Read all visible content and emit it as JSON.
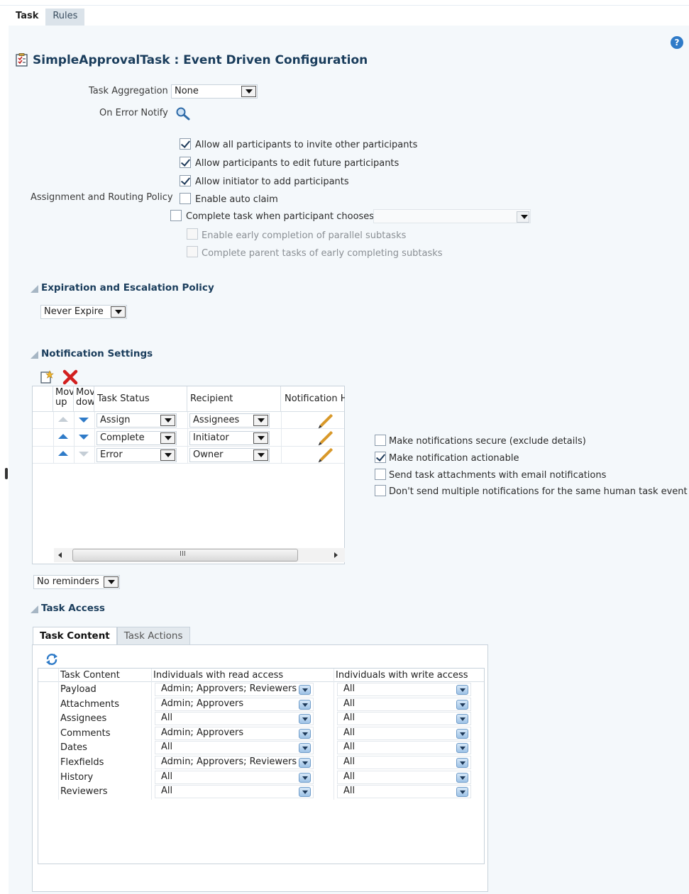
{
  "top_tabs": [
    "Task",
    "Rules"
  ],
  "title": "SimpleApprovalTask : Event Driven Configuration",
  "help_label": "?",
  "task_aggregation": {
    "label": "Task Aggregation",
    "value": "None"
  },
  "on_error_notify": {
    "label": "On Error Notify"
  },
  "assignment_label": "Assignment and Routing Policy",
  "assignment_options": [
    {
      "label": "Allow all participants to invite other participants",
      "checked": true
    },
    {
      "label": "Allow participants to edit future participants",
      "checked": true
    },
    {
      "label": "Allow initiator to add participants",
      "checked": true
    },
    {
      "label": "Enable auto claim",
      "checked": false
    },
    {
      "label": "Complete task when participant chooses",
      "checked": false
    },
    {
      "label": "Enable early completion of parallel subtasks",
      "checked": false,
      "disabled": true
    },
    {
      "label": "Complete parent tasks of early completing subtasks",
      "checked": false,
      "disabled": true
    }
  ],
  "expiration": {
    "header": "Expiration and Escalation Policy",
    "value": "Never Expire"
  },
  "notification": {
    "header": "Notification Settings",
    "columns": [
      "Mov up",
      "Mov dow",
      "Task Status",
      "Recipient",
      "Notification H"
    ],
    "rows": [
      {
        "status": "Assign",
        "recipient": "Assignees"
      },
      {
        "status": "Complete",
        "recipient": "Initiator"
      },
      {
        "status": "Error",
        "recipient": "Owner"
      }
    ],
    "scroll_label": "III",
    "options": [
      {
        "label": "Make notifications secure (exclude details)",
        "checked": false
      },
      {
        "label": "Make notification actionable",
        "checked": true
      },
      {
        "label": "Send task attachments with email notifications",
        "checked": false
      },
      {
        "label": "Don't send multiple notifications for the same human task event",
        "checked": false
      }
    ],
    "reminders": "No reminders"
  },
  "task_access": {
    "header": "Task Access",
    "tabs": [
      "Task Content",
      "Task Actions"
    ],
    "columns": [
      "Task Content",
      "Individuals with read access",
      "Individuals with write access"
    ],
    "rows": [
      {
        "content": "Payload",
        "read": "Admin; Approvers; Reviewers",
        "write": "All"
      },
      {
        "content": "Attachments",
        "read": "Admin; Approvers",
        "write": "All"
      },
      {
        "content": "Assignees",
        "read": "All",
        "write": "All"
      },
      {
        "content": "Comments",
        "read": "Admin; Approvers",
        "write": "All"
      },
      {
        "content": "Dates",
        "read": "All",
        "write": "All"
      },
      {
        "content": "Flexfields",
        "read": "Admin; Approvers; Reviewers",
        "write": "All"
      },
      {
        "content": "History",
        "read": "All",
        "write": "All"
      },
      {
        "content": "Reviewers",
        "read": "All",
        "write": "All"
      }
    ]
  }
}
